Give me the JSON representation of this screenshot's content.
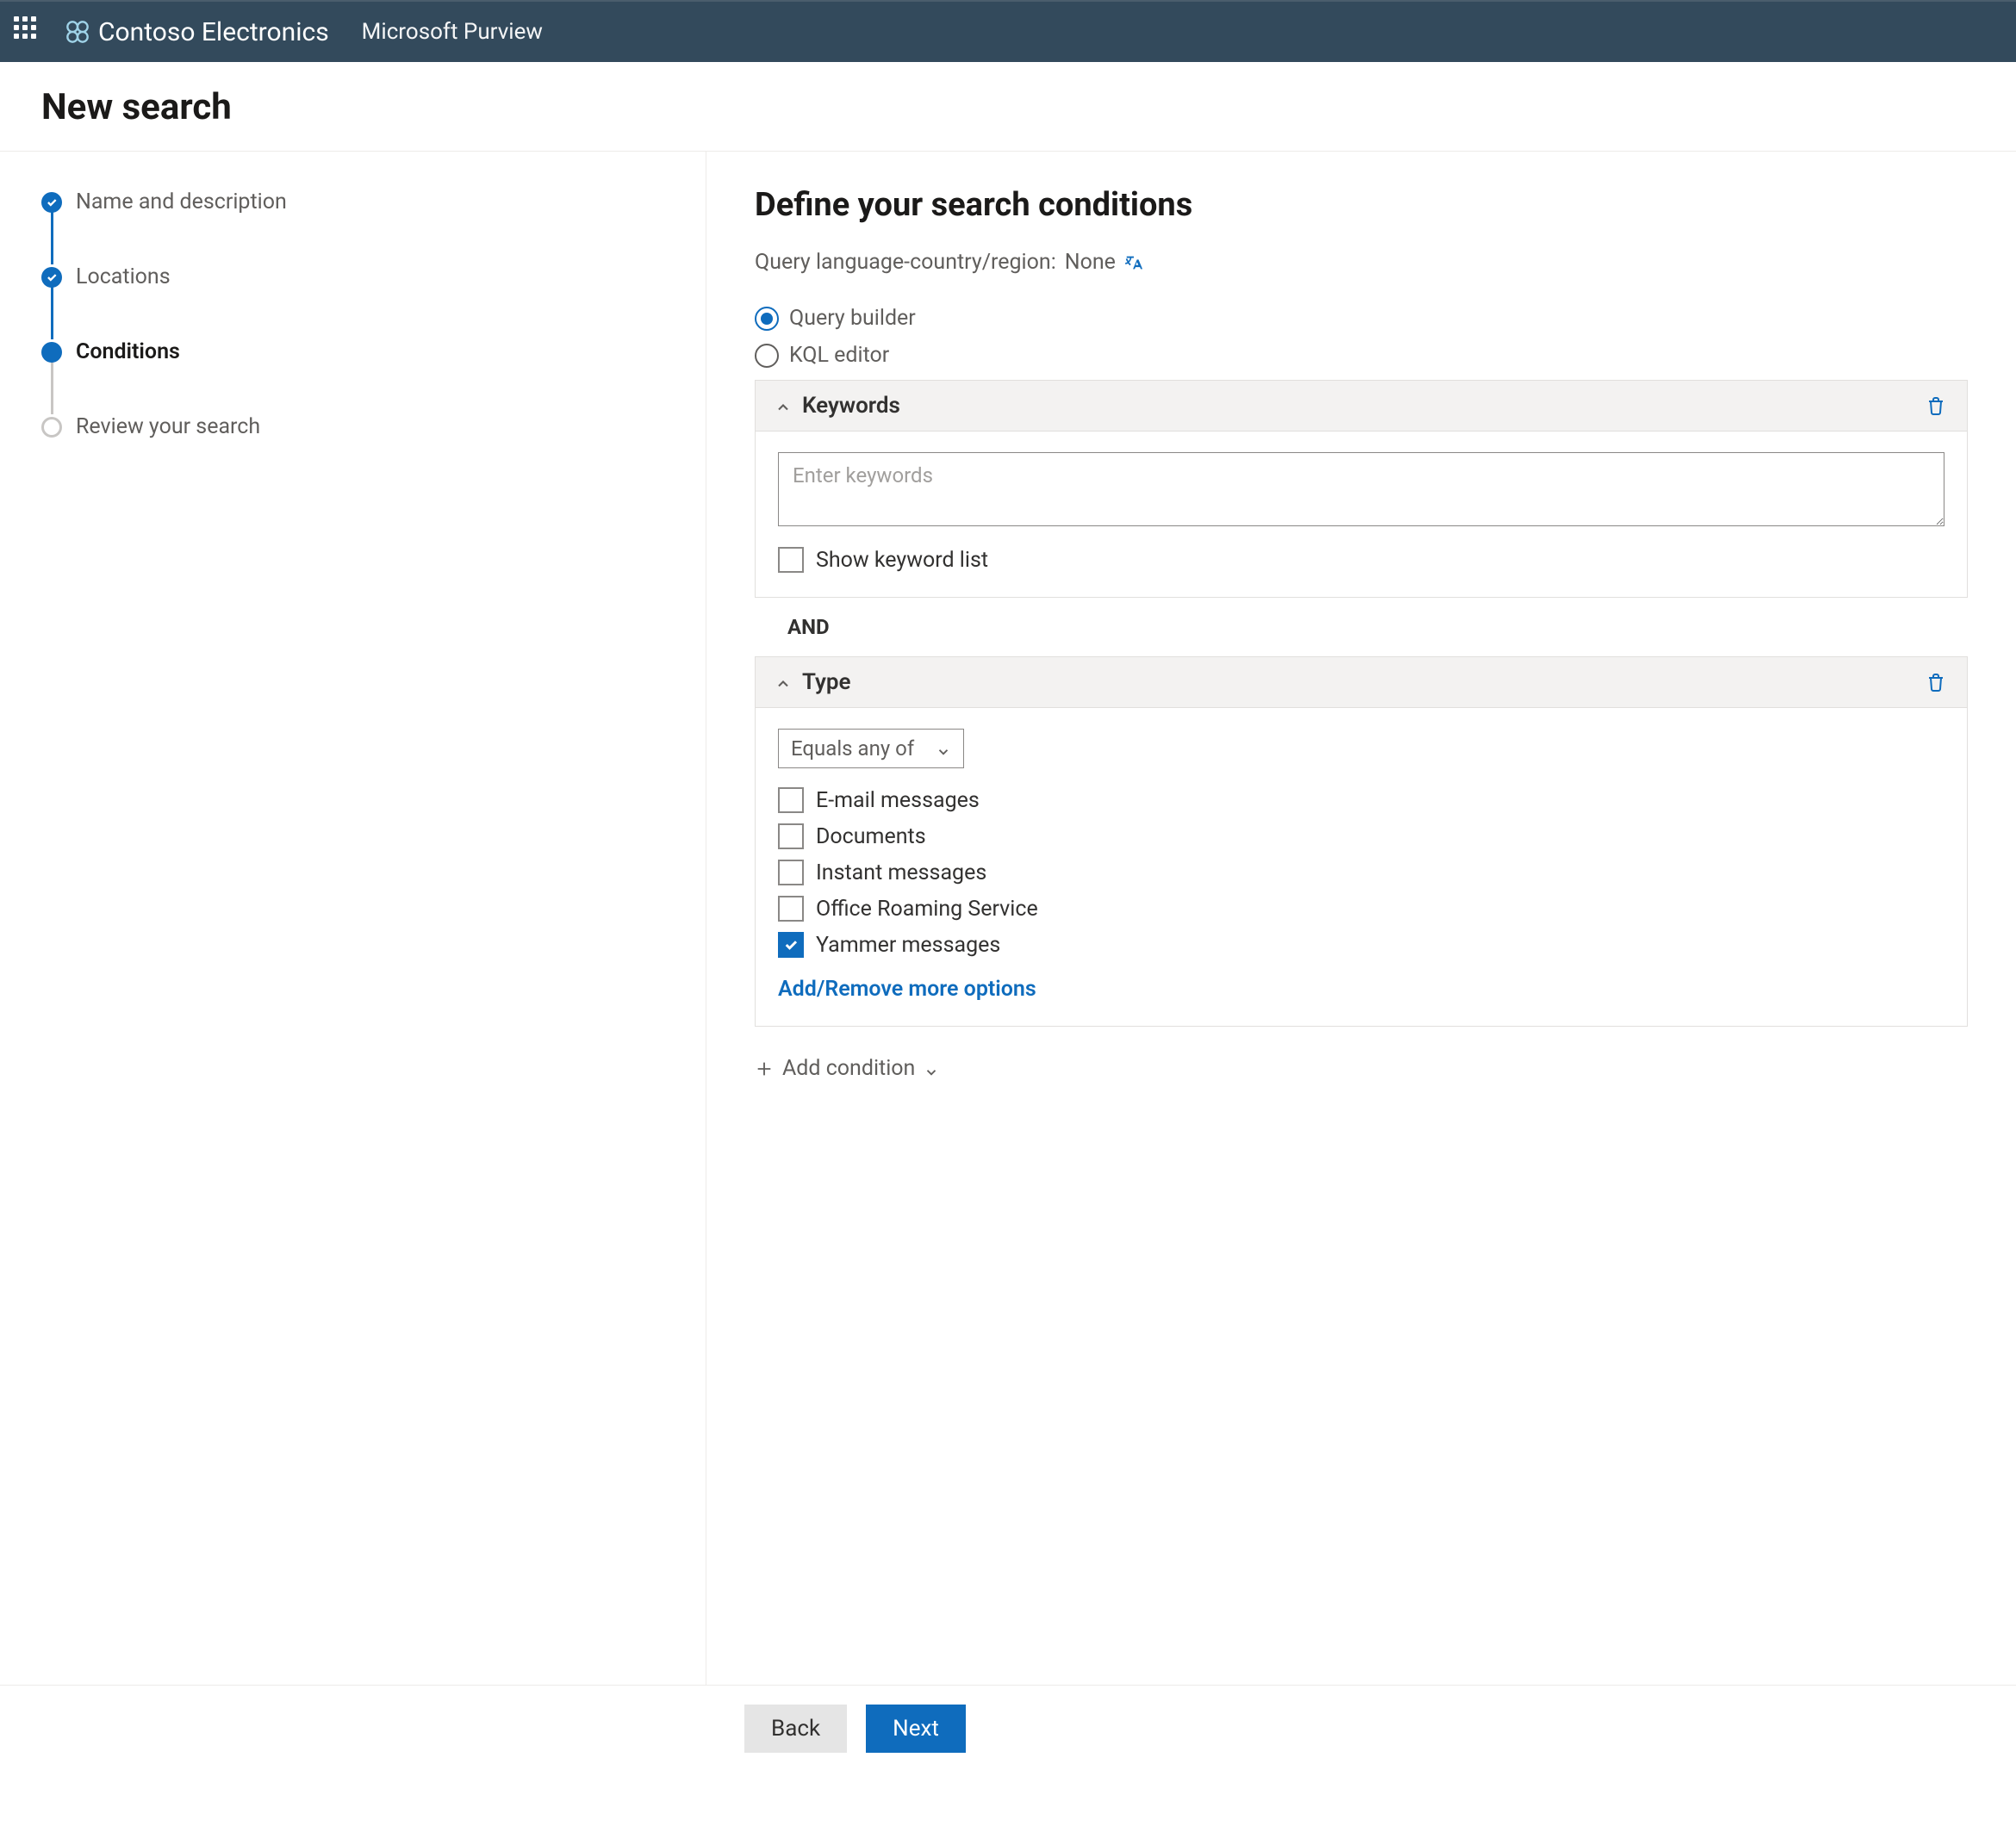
{
  "header": {
    "org": "Contoso Electronics",
    "product": "Microsoft Purview"
  },
  "page_title": "New search",
  "steps": [
    {
      "label": "Name and description",
      "state": "done"
    },
    {
      "label": "Locations",
      "state": "done"
    },
    {
      "label": "Conditions",
      "state": "active"
    },
    {
      "label": "Review your search",
      "state": "pending"
    }
  ],
  "main": {
    "heading": "Define your search conditions",
    "query_lang_label": "Query language-country/region:",
    "query_lang_value": "None",
    "mode_options": {
      "builder": "Query builder",
      "kql": "KQL editor",
      "selected": "builder"
    },
    "keywords_card": {
      "title": "Keywords",
      "placeholder": "Enter keywords",
      "value": "",
      "show_list_label": "Show keyword list",
      "show_list_checked": false
    },
    "join_operator": "AND",
    "type_card": {
      "title": "Type",
      "operator": "Equals any of",
      "options": [
        {
          "label": "E-mail messages",
          "checked": false
        },
        {
          "label": "Documents",
          "checked": false
        },
        {
          "label": "Instant messages",
          "checked": false
        },
        {
          "label": "Office Roaming Service",
          "checked": false
        },
        {
          "label": "Yammer messages",
          "checked": true
        }
      ],
      "more_options": "Add/Remove more options"
    },
    "add_condition": "Add condition"
  },
  "footer": {
    "back": "Back",
    "next": "Next"
  }
}
